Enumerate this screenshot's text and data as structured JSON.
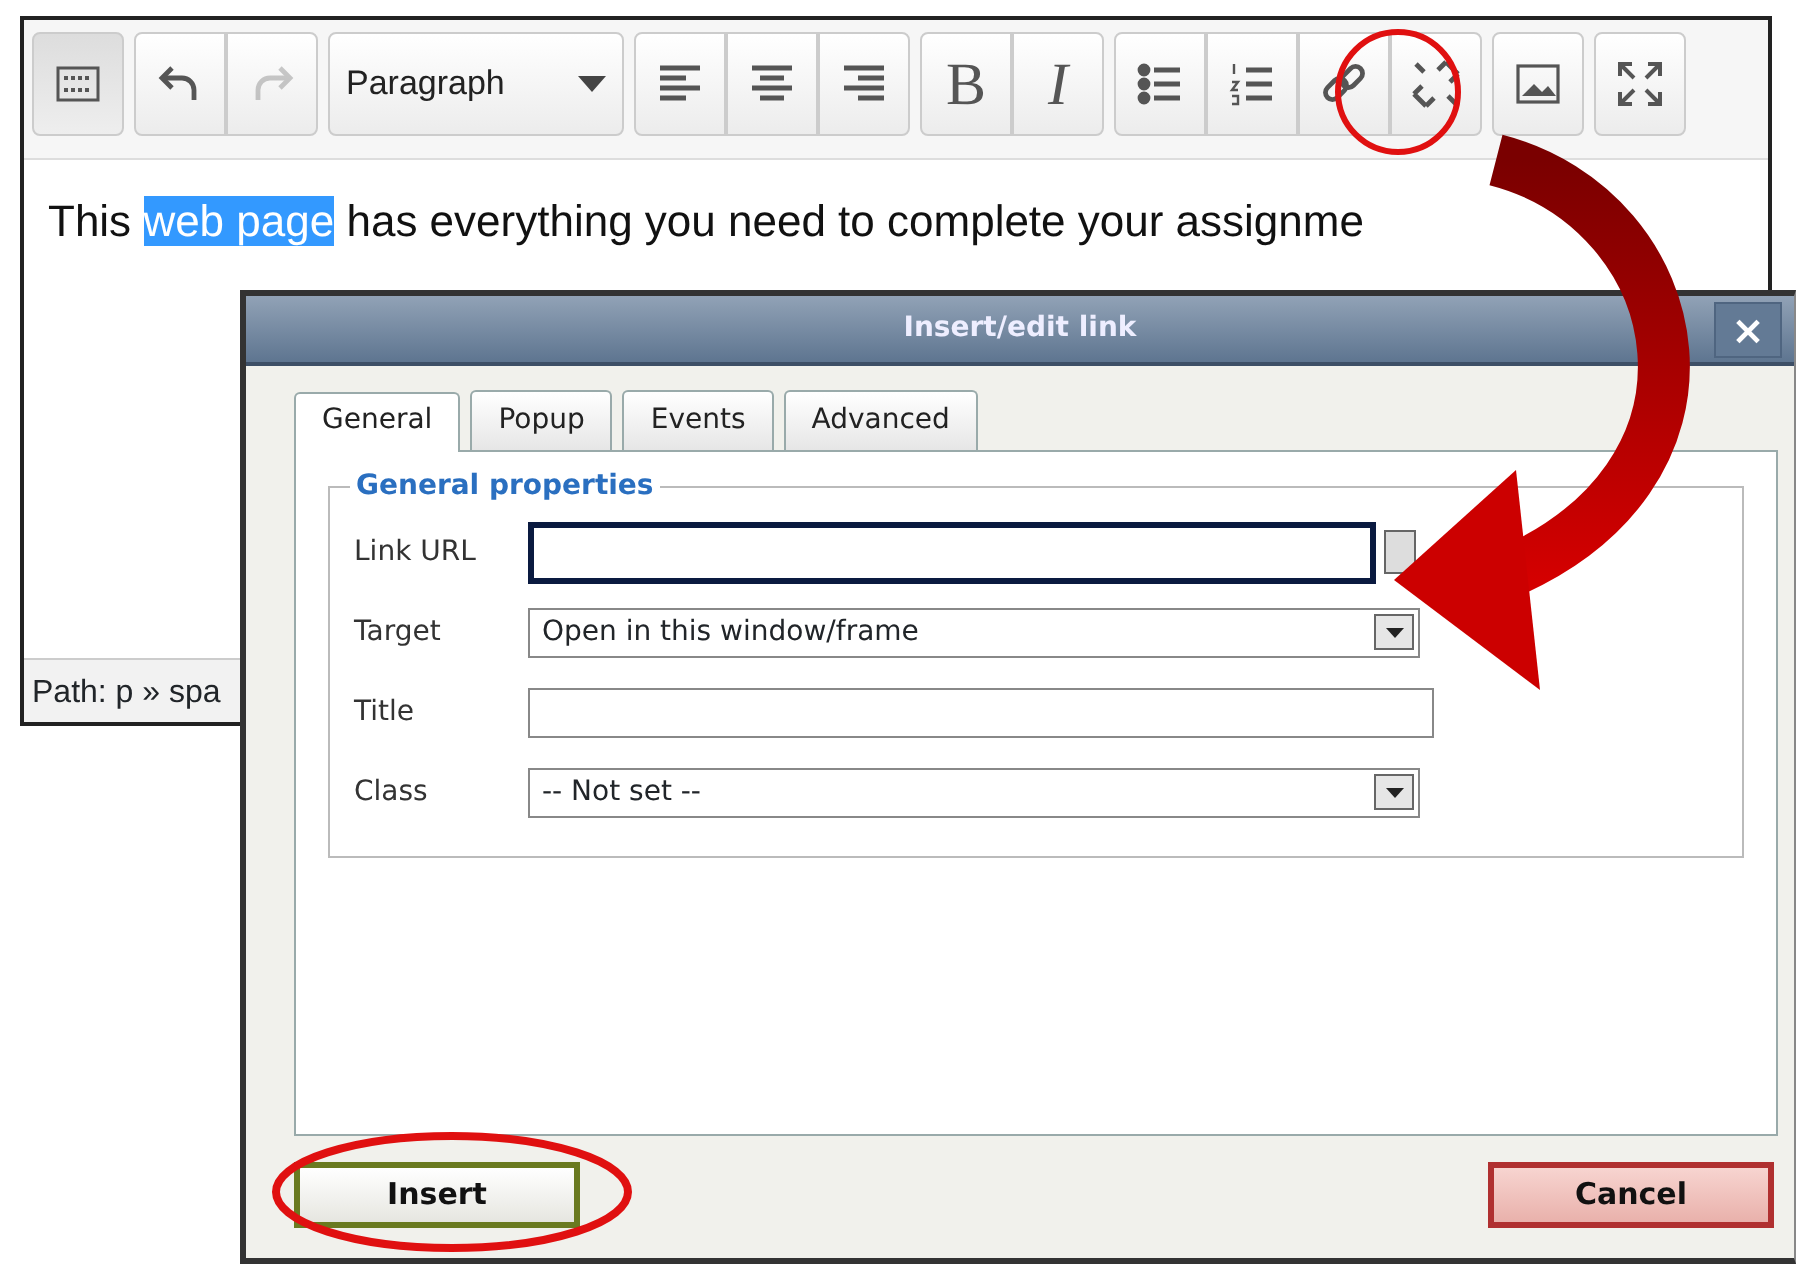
{
  "toolbar": {
    "groups": [
      {
        "buttons": [
          {
            "kind": "icon",
            "active": true,
            "disabled": false
          }
        ]
      },
      {
        "buttons": [
          {
            "kind": "icon",
            "active": false,
            "disabled": false
          },
          {
            "kind": "icon",
            "active": false,
            "disabled": true
          }
        ]
      },
      {
        "buttons": [
          {
            "kind": "dropdown",
            "label": "Paragraph",
            "active": false,
            "disabled": false
          }
        ]
      },
      {
        "buttons": [
          {
            "kind": "icon",
            "active": false,
            "disabled": false
          },
          {
            "kind": "icon",
            "active": false,
            "disabled": false
          },
          {
            "kind": "icon",
            "active": false,
            "disabled": false
          }
        ]
      },
      {
        "buttons": [
          {
            "kind": "glyph",
            "label": "B",
            "active": false,
            "disabled": false
          },
          {
            "kind": "glyph",
            "label": "I",
            "active": false,
            "disabled": false
          }
        ]
      },
      {
        "buttons": [
          {
            "kind": "icon",
            "active": false,
            "disabled": false
          },
          {
            "kind": "icon",
            "active": false,
            "disabled": false
          },
          {
            "kind": "icon",
            "active": false,
            "disabled": false
          },
          {
            "kind": "icon",
            "active": false,
            "disabled": false
          }
        ]
      },
      {
        "buttons": [
          {
            "kind": "icon",
            "active": false,
            "disabled": false
          }
        ]
      },
      {
        "buttons": [
          {
            "kind": "icon",
            "active": false,
            "disabled": false
          }
        ]
      }
    ]
  },
  "content": {
    "segments": [
      {
        "text": "This ",
        "selected": false
      },
      {
        "text": "web page",
        "selected": true
      },
      {
        "text": " has everything you need to complete your assignme",
        "selected": false
      }
    ]
  },
  "path_bar": "Path: p » spa",
  "dialog": {
    "title": "Insert/edit link",
    "close": "×",
    "tabs": [
      {
        "label": "General",
        "selected": true
      },
      {
        "label": "Popup",
        "selected": false
      },
      {
        "label": "Events",
        "selected": false
      },
      {
        "label": "Advanced",
        "selected": false
      }
    ],
    "legend": "General properties",
    "fields": [
      {
        "label": "Link URL",
        "kind": "text",
        "focused": true,
        "browse_button": true
      },
      {
        "label": "Target",
        "kind": "select",
        "value": "Open in this window/frame",
        "focused": false
      },
      {
        "label": "Title",
        "kind": "text",
        "focused": false
      },
      {
        "label": "Class",
        "kind": "select",
        "value": "-- Not set --",
        "focused": false
      }
    ],
    "buttons": [
      {
        "label": "Insert",
        "kind": "primary"
      },
      {
        "label": "Cancel",
        "kind": "cancel"
      }
    ]
  }
}
